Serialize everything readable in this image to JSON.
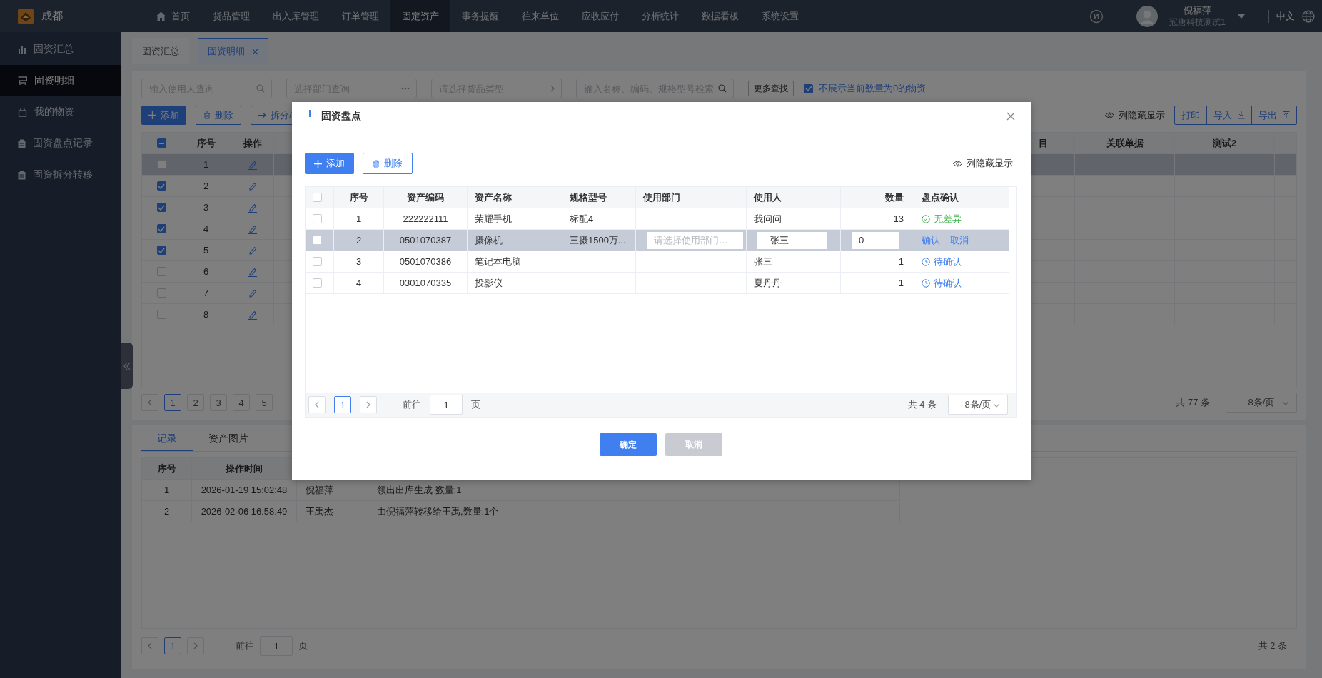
{
  "app": {
    "city": "成都"
  },
  "nav": [
    {
      "label": "首页",
      "kind": "home",
      "selected": false
    },
    {
      "label": "货品管理",
      "selected": false
    },
    {
      "label": "出入库管理",
      "selected": false
    },
    {
      "label": "订单管理",
      "selected": false
    },
    {
      "label": "固定资产",
      "selected": true
    },
    {
      "label": "事务提醒",
      "selected": false
    },
    {
      "label": "往来单位",
      "selected": false
    },
    {
      "label": "应收应付",
      "selected": false
    },
    {
      "label": "分析统计",
      "selected": false
    },
    {
      "label": "数据看板",
      "selected": false
    },
    {
      "label": "系统设置",
      "selected": false
    }
  ],
  "user": {
    "name": "倪福萍",
    "company": "冠唐科技测试1"
  },
  "language": "中文",
  "sidebar": [
    {
      "label": "固资汇总",
      "kind": "chart",
      "selected": false
    },
    {
      "label": "固资明细",
      "kind": "cart",
      "selected": true
    },
    {
      "label": "我的物资",
      "kind": "bag",
      "selected": false
    },
    {
      "label": "固资盘点记录",
      "kind": "clipboard",
      "selected": false
    },
    {
      "label": "固资拆分转移",
      "kind": "clipboard",
      "selected": false
    }
  ],
  "page_tabs": [
    {
      "label": "固资汇总",
      "selected": false,
      "closable": false
    },
    {
      "label": "固资明细",
      "selected": true,
      "closable": true
    }
  ],
  "filters": {
    "user_search": {
      "placeholder": "输入使用人查询"
    },
    "department": {
      "placeholder": "选择部门查询"
    },
    "goods_type": {
      "placeholder": "请选择货品类型"
    },
    "keyword": {
      "placeholder": "输入名称、编码、规格型号检索"
    },
    "more_button": "更多查找",
    "hide_zero": {
      "label": "不展示当前数量为0的物资",
      "checked": true
    }
  },
  "toolbar": {
    "add": "添加",
    "delete": "删除",
    "split": "拆分/",
    "column_toggle": "列隐藏显示",
    "print": "打印",
    "import": "导入",
    "export": "导出"
  },
  "main_table": {
    "indeterminate": true,
    "columns": [
      "序号",
      "操作",
      "目",
      "关联单据",
      "测试2"
    ],
    "rows": [
      {
        "seq": "1",
        "checked": false,
        "selected": true
      },
      {
        "seq": "2",
        "checked": true,
        "selected": false
      },
      {
        "seq": "3",
        "checked": true,
        "selected": false
      },
      {
        "seq": "4",
        "checked": true,
        "selected": false
      },
      {
        "seq": "5",
        "checked": true,
        "selected": false
      },
      {
        "seq": "6",
        "checked": false,
        "selected": false
      },
      {
        "seq": "7",
        "checked": false,
        "selected": false
      },
      {
        "seq": "8",
        "checked": false,
        "selected": false
      }
    ],
    "pager": {
      "pages": [
        {
          "label": "1",
          "selected": true
        },
        {
          "label": "2",
          "selected": false
        },
        {
          "label": "3",
          "selected": false
        },
        {
          "label": "4",
          "selected": false
        },
        {
          "label": "5",
          "selected": false
        }
      ],
      "total": "共 77 条",
      "page_size": "8条/页"
    }
  },
  "bottom_tabs": [
    {
      "label": "记录",
      "selected": true
    },
    {
      "label": "资产图片",
      "selected": false
    }
  ],
  "records_table": {
    "columns": [
      "序号",
      "操作时间"
    ],
    "rows": [
      [
        "1",
        "2026-01-19 15:02:48",
        "倪福萍",
        "领出出库生成 数量:1"
      ],
      [
        "2",
        "2026-02-06 16:58:49",
        "王禹杰",
        "由倪福萍转移给王禹,数量:1个"
      ]
    ],
    "pager": {
      "pages": [
        {
          "label": "1",
          "selected": true
        }
      ],
      "goto": "前往",
      "goto_value": "1",
      "unit": "页",
      "total": "共 2 条"
    }
  },
  "dialog": {
    "title": "固资盘点",
    "add": "添加",
    "delete": "删除",
    "column_toggle": "列隐藏显示",
    "all_checked": false,
    "columns": [
      "序号",
      "资产编码",
      "资产名称",
      "规格型号",
      "使用部门",
      "使用人",
      "数量",
      "盘点确认"
    ],
    "rows": [
      {
        "kind": "view",
        "selected": false,
        "checked": false,
        "seq": "1",
        "code": "222222111",
        "name": "荣耀手机",
        "spec": "标配4",
        "dept": "",
        "user": "我问问",
        "qty": "13",
        "status": {
          "kind": "ok",
          "label": "无差异"
        }
      },
      {
        "kind": "edit",
        "selected": true,
        "checked": false,
        "seq": "2",
        "code": "0501070387",
        "name": "摄像机",
        "spec": "三摄1500万...",
        "dept_placeholder": "请选择使用部门…",
        "user": "张三",
        "qty": "0",
        "actions": [
          "确认",
          "取消"
        ]
      },
      {
        "kind": "view",
        "selected": false,
        "checked": false,
        "seq": "3",
        "code": "0501070386",
        "name": "笔记本电脑",
        "spec": "",
        "dept": "",
        "user": "张三",
        "qty": "1",
        "status": {
          "kind": "pending",
          "label": "待确认"
        }
      },
      {
        "kind": "view",
        "selected": false,
        "checked": false,
        "seq": "4",
        "code": "0301070335",
        "name": "投影仪",
        "spec": "",
        "dept": "",
        "user": "夏丹丹",
        "qty": "1",
        "status": {
          "kind": "pending",
          "label": "待确认"
        }
      }
    ],
    "pager": {
      "pages": [
        {
          "label": "1",
          "selected": true
        }
      ],
      "goto": "前往",
      "goto_value": "1",
      "unit": "页",
      "total": "共 4 条",
      "page_size": "8条/页"
    },
    "confirm": "确定",
    "cancel": "取消"
  }
}
